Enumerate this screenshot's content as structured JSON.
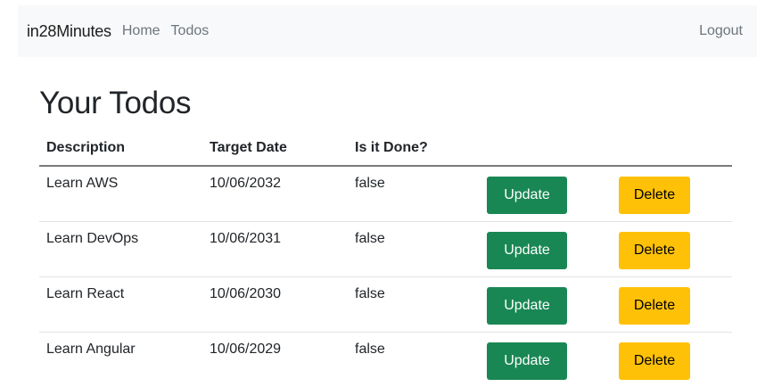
{
  "navbar": {
    "brand": "in28Minutes",
    "links": [
      {
        "label": "Home"
      },
      {
        "label": "Todos"
      }
    ],
    "logout": "Logout"
  },
  "page": {
    "title": "Your Todos"
  },
  "table": {
    "headers": [
      "Description",
      "Target Date",
      "Is it Done?"
    ],
    "rows": [
      {
        "description": "Learn AWS",
        "target_date": "10/06/2032",
        "done": "false",
        "update": "Update",
        "delete": "Delete"
      },
      {
        "description": "Learn DevOps",
        "target_date": "10/06/2031",
        "done": "false",
        "update": "Update",
        "delete": "Delete"
      },
      {
        "description": "Learn React",
        "target_date": "10/06/2030",
        "done": "false",
        "update": "Update",
        "delete": "Delete"
      },
      {
        "description": "Learn Angular",
        "target_date": "10/06/2029",
        "done": "false",
        "update": "Update",
        "delete": "Delete"
      }
    ]
  },
  "colors": {
    "update_button": "#198754",
    "delete_button": "#ffc107",
    "navbar_bg": "#f8f9fa"
  }
}
